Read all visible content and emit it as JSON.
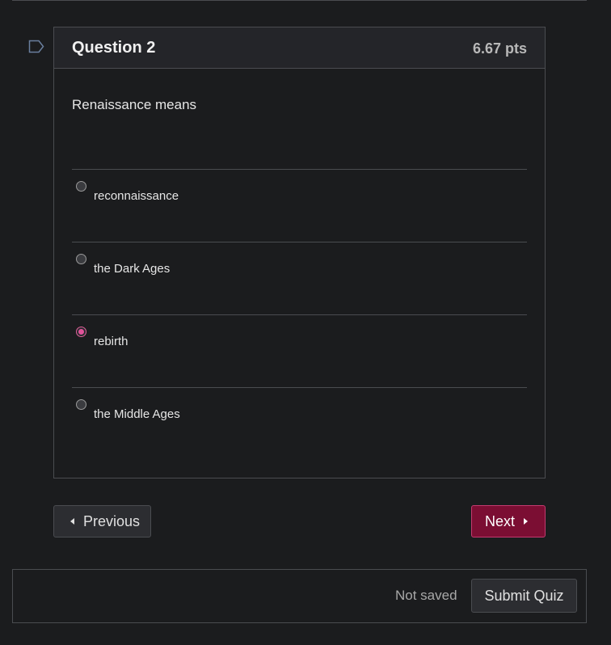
{
  "question": {
    "title": "Question 2",
    "points": "6.67 pts",
    "text": "Renaissance means",
    "answers": [
      {
        "label": "reconnaissance",
        "selected": false
      },
      {
        "label": "the Dark Ages",
        "selected": false
      },
      {
        "label": "rebirth",
        "selected": true
      },
      {
        "label": "the Middle Ages",
        "selected": false
      }
    ]
  },
  "navigation": {
    "previous_label": "Previous",
    "next_label": "Next"
  },
  "footer": {
    "save_status": "Not saved",
    "submit_label": "Submit Quiz"
  },
  "colors": {
    "background": "#1b1c1e",
    "next_button": "#7b0e33",
    "selected_radio": "#e2539a"
  },
  "icons": {
    "flag": "flag-outline-icon",
    "previous": "caret-left-icon",
    "next": "caret-right-icon"
  }
}
